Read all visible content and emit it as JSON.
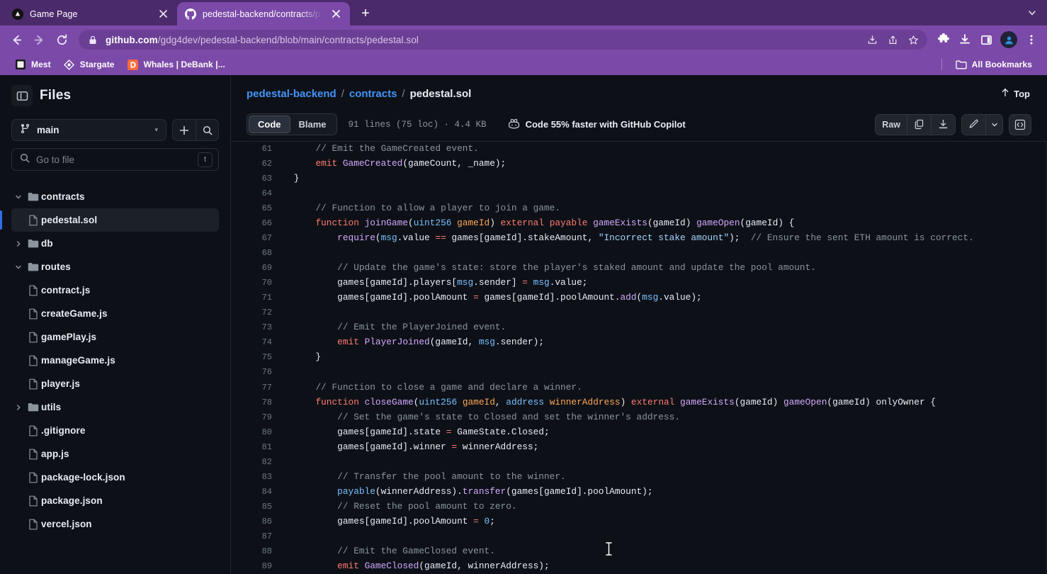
{
  "browser": {
    "tabs": [
      {
        "title": "Game Page",
        "favicon": "triangle-icon",
        "active": false
      },
      {
        "title": "pedestal-backend/contracts/p",
        "favicon": "github-icon",
        "active": true
      }
    ],
    "new_tab_label": "+",
    "tab_list_caret": "⌄",
    "nav": {
      "back": "←",
      "forward": "→",
      "reload": "⟳"
    },
    "url": {
      "domain": "github.com",
      "path": "/gdg4dev/pedestal-backend/blob/main/contracts/pedestal.sol"
    },
    "omnibox_icons": [
      "install-icon",
      "share-icon",
      "bookmark-star-icon"
    ],
    "toolbar_icons": [
      "extensions-puzzle-icon",
      "downloads-icon",
      "side-panel-icon",
      "profile-avatar",
      "chrome-menu-icon"
    ],
    "bookmarks": [
      {
        "label": "Mest",
        "icon": "square-icon"
      },
      {
        "label": "Stargate",
        "icon": "diamond-icon"
      },
      {
        "label": "Whales | DeBank |...",
        "icon": "debank-icon"
      }
    ],
    "all_bookmarks_label": "All Bookmarks"
  },
  "sidebar": {
    "title": "Files",
    "toggle_icon": "sidebar-collapse-icon",
    "branch": {
      "name": "main",
      "icon": "git-branch-icon",
      "caret": "▾"
    },
    "add_button": "+",
    "search_button_icon": "search-icon",
    "file_search": {
      "placeholder": "Go to file",
      "shortcut": "t",
      "icon": "search-icon"
    },
    "tree": [
      {
        "label": "contracts",
        "type": "folder",
        "expanded": true,
        "indent": 0,
        "selected": false
      },
      {
        "label": "pedestal.sol",
        "type": "file",
        "indent": 1,
        "selected": true
      },
      {
        "label": "db",
        "type": "folder",
        "expanded": false,
        "indent": 0,
        "selected": false
      },
      {
        "label": "routes",
        "type": "folder",
        "expanded": true,
        "indent": 0,
        "selected": false
      },
      {
        "label": "contract.js",
        "type": "file",
        "indent": 1,
        "selected": false
      },
      {
        "label": "createGame.js",
        "type": "file",
        "indent": 1,
        "selected": false
      },
      {
        "label": "gamePlay.js",
        "type": "file",
        "indent": 1,
        "selected": false
      },
      {
        "label": "manageGame.js",
        "type": "file",
        "indent": 1,
        "selected": false
      },
      {
        "label": "player.js",
        "type": "file",
        "indent": 1,
        "selected": false
      },
      {
        "label": "utils",
        "type": "folder",
        "expanded": false,
        "indent": 0,
        "selected": false
      },
      {
        "label": ".gitignore",
        "type": "file",
        "indent": 0,
        "selected": false
      },
      {
        "label": "app.js",
        "type": "file",
        "indent": 0,
        "selected": false
      },
      {
        "label": "package-lock.json",
        "type": "file",
        "indent": 0,
        "selected": false
      },
      {
        "label": "package.json",
        "type": "file",
        "indent": 0,
        "selected": false
      },
      {
        "label": "vercel.json",
        "type": "file",
        "indent": 0,
        "selected": false
      }
    ]
  },
  "main": {
    "breadcrumb": {
      "repo": "pedestal-backend",
      "sep": "/",
      "folder": "contracts",
      "file": "pedestal.sol"
    },
    "top_link": {
      "label": "Top",
      "icon": "arrow-up-icon"
    },
    "tabs": [
      {
        "label": "Code",
        "active": true
      },
      {
        "label": "Blame",
        "active": false
      }
    ],
    "file_meta": "91 lines (75 loc) · 4.4 KB",
    "copilot_banner": {
      "label": "Code 55% faster with GitHub Copilot",
      "icon": "copilot-icon"
    },
    "actions": {
      "raw": "Raw",
      "copy_icon": "copy-icon",
      "download_icon": "download-icon",
      "edit_icon": "pencil-icon",
      "edit_caret": "▾",
      "symbols_icon": "code-brackets-icon"
    }
  },
  "code": {
    "language": "solidity",
    "first_line": 61,
    "lines": [
      {
        "n": 61,
        "tokens": [
          {
            "t": "        ",
            "c": "pln"
          },
          {
            "t": "// Emit the GameCreated event.",
            "c": "com"
          }
        ]
      },
      {
        "n": 62,
        "tokens": [
          {
            "t": "        ",
            "c": "pln"
          },
          {
            "t": "emit",
            "c": "kw"
          },
          {
            "t": " ",
            "c": "pln"
          },
          {
            "t": "GameCreated",
            "c": "fn"
          },
          {
            "t": "(gameCount, _name);",
            "c": "pln"
          }
        ]
      },
      {
        "n": 63,
        "tokens": [
          {
            "t": "    }",
            "c": "pln"
          }
        ]
      },
      {
        "n": 64,
        "tokens": [
          {
            "t": "",
            "c": "pln"
          }
        ]
      },
      {
        "n": 65,
        "tokens": [
          {
            "t": "        ",
            "c": "pln"
          },
          {
            "t": "// Function to allow a player to join a game.",
            "c": "com"
          }
        ]
      },
      {
        "n": 66,
        "tokens": [
          {
            "t": "        ",
            "c": "pln"
          },
          {
            "t": "function",
            "c": "kw"
          },
          {
            "t": " ",
            "c": "pln"
          },
          {
            "t": "joinGame",
            "c": "fn"
          },
          {
            "t": "(",
            "c": "pln"
          },
          {
            "t": "uint256",
            "c": "typ"
          },
          {
            "t": " ",
            "c": "pln"
          },
          {
            "t": "gameId",
            "c": "var"
          },
          {
            "t": ") ",
            "c": "pln"
          },
          {
            "t": "external",
            "c": "kw"
          },
          {
            "t": " ",
            "c": "pln"
          },
          {
            "t": "payable",
            "c": "kw"
          },
          {
            "t": " ",
            "c": "pln"
          },
          {
            "t": "gameExists",
            "c": "fn"
          },
          {
            "t": "(gameId) ",
            "c": "pln"
          },
          {
            "t": "gameOpen",
            "c": "fn"
          },
          {
            "t": "(gameId) {",
            "c": "pln"
          }
        ]
      },
      {
        "n": 67,
        "tokens": [
          {
            "t": "            ",
            "c": "pln"
          },
          {
            "t": "require",
            "c": "fn"
          },
          {
            "t": "(",
            "c": "pln"
          },
          {
            "t": "msg",
            "c": "typ"
          },
          {
            "t": ".value ",
            "c": "pln"
          },
          {
            "t": "==",
            "c": "op"
          },
          {
            "t": " games[gameId].stakeAmount, ",
            "c": "pln"
          },
          {
            "t": "\"Incorrect stake amount\"",
            "c": "str"
          },
          {
            "t": ");  ",
            "c": "pln"
          },
          {
            "t": "// Ensure the sent ETH amount is correct.",
            "c": "com"
          }
        ]
      },
      {
        "n": 68,
        "tokens": [
          {
            "t": "",
            "c": "pln"
          }
        ]
      },
      {
        "n": 69,
        "tokens": [
          {
            "t": "            ",
            "c": "pln"
          },
          {
            "t": "// Update the game's state: store the player's staked amount and update the pool amount.",
            "c": "com"
          }
        ]
      },
      {
        "n": 70,
        "tokens": [
          {
            "t": "            games[gameId].players[",
            "c": "pln"
          },
          {
            "t": "msg",
            "c": "typ"
          },
          {
            "t": ".sender] ",
            "c": "pln"
          },
          {
            "t": "=",
            "c": "op"
          },
          {
            "t": " ",
            "c": "pln"
          },
          {
            "t": "msg",
            "c": "typ"
          },
          {
            "t": ".value;",
            "c": "pln"
          }
        ]
      },
      {
        "n": 71,
        "tokens": [
          {
            "t": "            games[gameId].poolAmount ",
            "c": "pln"
          },
          {
            "t": "=",
            "c": "op"
          },
          {
            "t": " games[gameId].poolAmount.",
            "c": "pln"
          },
          {
            "t": "add",
            "c": "fn"
          },
          {
            "t": "(",
            "c": "pln"
          },
          {
            "t": "msg",
            "c": "typ"
          },
          {
            "t": ".value);",
            "c": "pln"
          }
        ]
      },
      {
        "n": 72,
        "tokens": [
          {
            "t": "",
            "c": "pln"
          }
        ]
      },
      {
        "n": 73,
        "tokens": [
          {
            "t": "            ",
            "c": "pln"
          },
          {
            "t": "// Emit the PlayerJoined event.",
            "c": "com"
          }
        ]
      },
      {
        "n": 74,
        "tokens": [
          {
            "t": "            ",
            "c": "pln"
          },
          {
            "t": "emit",
            "c": "kw"
          },
          {
            "t": " ",
            "c": "pln"
          },
          {
            "t": "PlayerJoined",
            "c": "fn"
          },
          {
            "t": "(gameId, ",
            "c": "pln"
          },
          {
            "t": "msg",
            "c": "typ"
          },
          {
            "t": ".sender);",
            "c": "pln"
          }
        ]
      },
      {
        "n": 75,
        "tokens": [
          {
            "t": "        }",
            "c": "pln"
          }
        ]
      },
      {
        "n": 76,
        "tokens": [
          {
            "t": "",
            "c": "pln"
          }
        ]
      },
      {
        "n": 77,
        "tokens": [
          {
            "t": "        ",
            "c": "pln"
          },
          {
            "t": "// Function to close a game and declare a winner.",
            "c": "com"
          }
        ]
      },
      {
        "n": 78,
        "tokens": [
          {
            "t": "        ",
            "c": "pln"
          },
          {
            "t": "function",
            "c": "kw"
          },
          {
            "t": " ",
            "c": "pln"
          },
          {
            "t": "closeGame",
            "c": "fn"
          },
          {
            "t": "(",
            "c": "pln"
          },
          {
            "t": "uint256",
            "c": "typ"
          },
          {
            "t": " ",
            "c": "pln"
          },
          {
            "t": "gameId",
            "c": "var"
          },
          {
            "t": ", ",
            "c": "pln"
          },
          {
            "t": "address",
            "c": "typ"
          },
          {
            "t": " ",
            "c": "pln"
          },
          {
            "t": "winnerAddress",
            "c": "var"
          },
          {
            "t": ") ",
            "c": "pln"
          },
          {
            "t": "external",
            "c": "kw"
          },
          {
            "t": " ",
            "c": "pln"
          },
          {
            "t": "gameExists",
            "c": "fn"
          },
          {
            "t": "(gameId) ",
            "c": "pln"
          },
          {
            "t": "gameOpen",
            "c": "fn"
          },
          {
            "t": "(gameId) onlyOwner {",
            "c": "pln"
          }
        ]
      },
      {
        "n": 79,
        "tokens": [
          {
            "t": "            ",
            "c": "pln"
          },
          {
            "t": "// Set the game's state to Closed and set the winner's address.",
            "c": "com"
          }
        ]
      },
      {
        "n": 80,
        "tokens": [
          {
            "t": "            games[gameId].state ",
            "c": "pln"
          },
          {
            "t": "=",
            "c": "op"
          },
          {
            "t": " GameState.Closed;",
            "c": "pln"
          }
        ]
      },
      {
        "n": 81,
        "tokens": [
          {
            "t": "            games[gameId].winner ",
            "c": "pln"
          },
          {
            "t": "=",
            "c": "op"
          },
          {
            "t": " winnerAddress;",
            "c": "pln"
          }
        ]
      },
      {
        "n": 82,
        "tokens": [
          {
            "t": "",
            "c": "pln"
          }
        ]
      },
      {
        "n": 83,
        "tokens": [
          {
            "t": "            ",
            "c": "pln"
          },
          {
            "t": "// Transfer the pool amount to the winner.",
            "c": "com"
          }
        ]
      },
      {
        "n": 84,
        "tokens": [
          {
            "t": "            ",
            "c": "pln"
          },
          {
            "t": "payable",
            "c": "typ"
          },
          {
            "t": "(winnerAddress).",
            "c": "pln"
          },
          {
            "t": "transfer",
            "c": "fn"
          },
          {
            "t": "(games[gameId].poolAmount);",
            "c": "pln"
          }
        ]
      },
      {
        "n": 85,
        "tokens": [
          {
            "t": "            ",
            "c": "pln"
          },
          {
            "t": "// Reset the pool amount to zero.",
            "c": "com"
          }
        ]
      },
      {
        "n": 86,
        "tokens": [
          {
            "t": "            games[gameId].poolAmount ",
            "c": "pln"
          },
          {
            "t": "=",
            "c": "op"
          },
          {
            "t": " ",
            "c": "pln"
          },
          {
            "t": "0",
            "c": "num"
          },
          {
            "t": ";",
            "c": "pln"
          }
        ]
      },
      {
        "n": 87,
        "tokens": [
          {
            "t": "",
            "c": "pln"
          }
        ]
      },
      {
        "n": 88,
        "tokens": [
          {
            "t": "            ",
            "c": "pln"
          },
          {
            "t": "// Emit the GameClosed event.",
            "c": "com"
          }
        ]
      },
      {
        "n": 89,
        "tokens": [
          {
            "t": "            ",
            "c": "pln"
          },
          {
            "t": "emit",
            "c": "kw"
          },
          {
            "t": " ",
            "c": "pln"
          },
          {
            "t": "GameClosed",
            "c": "fn"
          },
          {
            "t": "(gameId, winnerAddress);",
            "c": "pln"
          }
        ]
      }
    ]
  },
  "colors": {
    "chrome_tabstrip": "#4b2a6b",
    "chrome_toolbar": "#7b4aa8",
    "page_bg": "#0d1117",
    "accent_link": "#4493f8",
    "selected_marker": "#2f6feb"
  }
}
